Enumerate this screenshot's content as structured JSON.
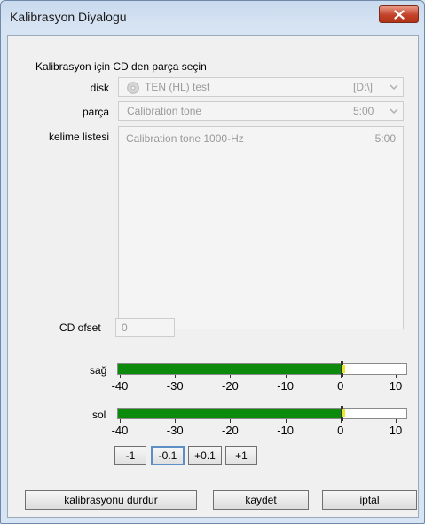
{
  "window": {
    "title": "Kalibrasyon Diyalogu",
    "close_icon": "close-icon"
  },
  "form": {
    "prompt": "Kalibrasyon için CD den  parça seçin",
    "disk": {
      "label": "disk",
      "value": "TEN (HL) test",
      "drive": "[D:\\]",
      "icon": "cd-disc-icon"
    },
    "track": {
      "label": "parça",
      "value": "Calibration tone",
      "duration": "5:00"
    },
    "word_list": {
      "label": "kelime listesi",
      "items": [
        {
          "title": "Calibration tone 1000-Hz",
          "duration": "5:00"
        }
      ]
    },
    "cd_offset": {
      "label": "CD ofset",
      "value": "0"
    }
  },
  "meters": {
    "scale_labels": [
      "-40",
      "-30",
      "-20",
      "-10",
      "0",
      "10"
    ],
    "scale_values": [
      -40,
      -30,
      -20,
      -10,
      0,
      10
    ],
    "range": [
      -40,
      10
    ],
    "right": {
      "label": "sağ",
      "level_db": 0
    },
    "left": {
      "label": "sol",
      "level_db": 0
    },
    "colors": {
      "fill": "#0b8a0b",
      "peak": "#e6e62a"
    }
  },
  "step_buttons": [
    {
      "label": "-1",
      "active": false
    },
    {
      "label": "-0.1",
      "active": true
    },
    {
      "label": "+0.1",
      "active": false
    },
    {
      "label": "+1",
      "active": false
    }
  ],
  "actions": {
    "stop_label": "kalibrasyonu durdur",
    "save_label": "kaydet",
    "cancel_label": "iptal"
  }
}
